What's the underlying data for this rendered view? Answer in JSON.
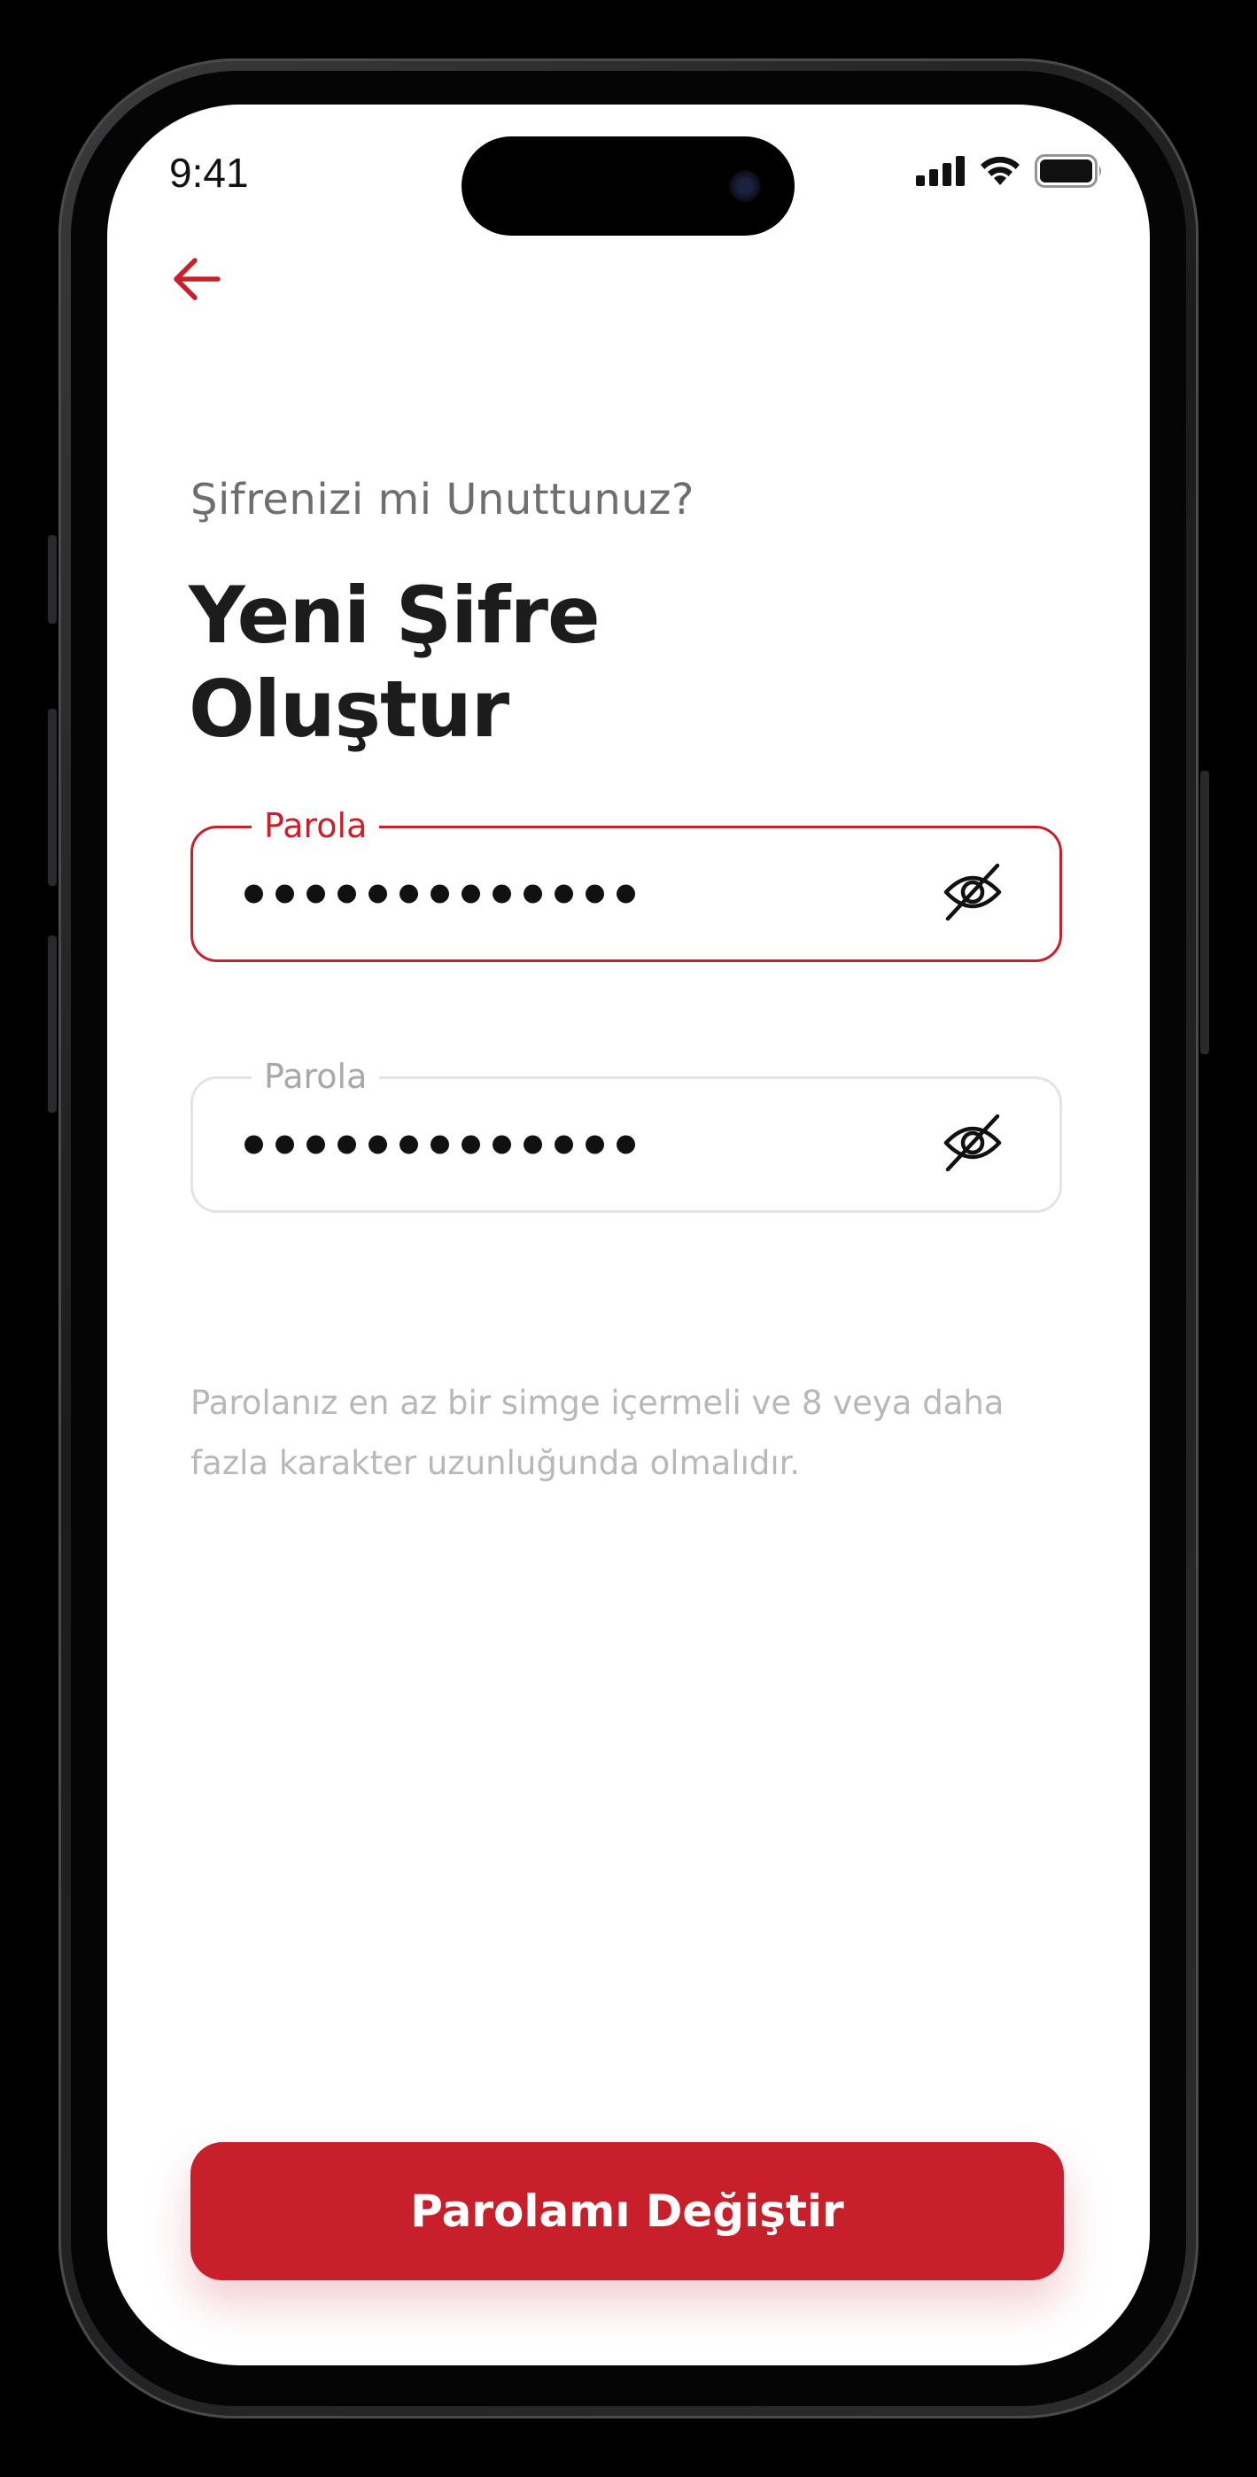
{
  "status_bar": {
    "time": "9:41",
    "icons": [
      "cellular-signal-icon",
      "wifi-icon",
      "battery-icon"
    ]
  },
  "header": {
    "back_icon": "arrow-left-icon"
  },
  "main": {
    "subtitle": "Şifrenizi mi Unuttunuz?",
    "title_line1": "Yeni Şifre",
    "title_line2": "Oluştur",
    "fields": [
      {
        "label": "Parola",
        "value_masked": "•••••••••••••",
        "state": "focused",
        "toggle_icon": "eye-off-icon"
      },
      {
        "label": "Parola",
        "value_masked": "•••••••••••••",
        "state": "default",
        "toggle_icon": "eye-off-icon"
      }
    ],
    "hint": "Parolanız en az bir simge içermeli ve 8 veya daha fazla karakter uzunluğunda olmalıdır."
  },
  "footer": {
    "submit_label": "Parolamı Değiştir"
  },
  "colors": {
    "accent": "#c8202a",
    "text_primary": "#1c1c1c",
    "text_secondary": "#6e6e6e",
    "hint": "#b8b8b8",
    "border_inactive": "#e4e4e4"
  }
}
